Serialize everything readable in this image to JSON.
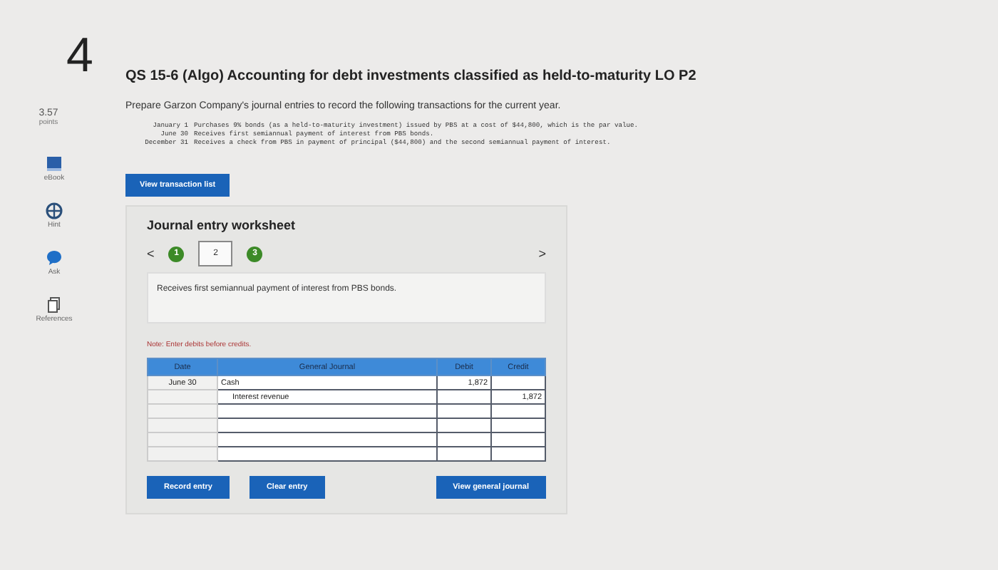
{
  "sidebar": {
    "question_number": "4",
    "score": "3.57",
    "score_label": "points",
    "tools": [
      {
        "kind": "book",
        "label": "eBook"
      },
      {
        "kind": "hint",
        "label": "Hint"
      },
      {
        "kind": "ask",
        "label": "Ask"
      },
      {
        "kind": "references",
        "label": "References"
      }
    ]
  },
  "question": {
    "title": "QS 15-6 (Algo) Accounting for debt investments classified as held-to-maturity LO P2",
    "prompt": "Prepare Garzon Company's journal entries to record the following transactions for the current year.",
    "transactions": [
      {
        "date": "January 1",
        "text": "Purchases 9% bonds (as a held-to-maturity investment) issued by PBS at a cost of $44,800, which is the par value."
      },
      {
        "date": "June 30",
        "text": "Receives first semiannual payment of interest from PBS bonds."
      },
      {
        "date": "December 31",
        "text": "Receives a check from PBS in payment of principal ($44,800) and the second semiannual payment of interest."
      }
    ],
    "transaction_list_button": "View transaction list"
  },
  "worksheet": {
    "title": "Journal entry worksheet",
    "prev": "<",
    "next": ">",
    "steps": [
      {
        "label": "1",
        "selected": false
      },
      {
        "label": "2",
        "selected": true
      },
      {
        "label": "3",
        "selected": false
      }
    ],
    "description": "Receives first semiannual payment of interest from PBS bonds.",
    "note": "Note: Enter debits before credits.",
    "columns": [
      "Date",
      "General Journal",
      "Debit",
      "Credit"
    ],
    "rows": [
      {
        "date": "June 30",
        "account": "Cash",
        "debit": "1,872",
        "credit": ""
      },
      {
        "date": "",
        "account": "Interest revenue",
        "debit": "",
        "credit": "1,872"
      },
      {
        "date": "",
        "account": "",
        "debit": "",
        "credit": ""
      },
      {
        "date": "",
        "account": "",
        "debit": "",
        "credit": ""
      },
      {
        "date": "",
        "account": "",
        "debit": "",
        "credit": ""
      },
      {
        "date": "",
        "account": "",
        "debit": "",
        "credit": ""
      }
    ],
    "buttons": {
      "record": "Record entry",
      "clear": "Clear entry",
      "view_journal": "View general journal"
    }
  }
}
